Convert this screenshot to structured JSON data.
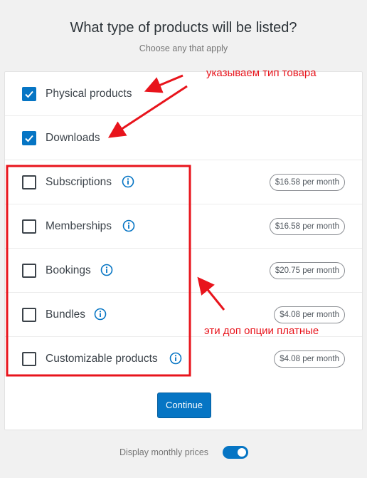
{
  "header": {
    "title": "What type of products will be listed?",
    "subtitle": "Choose any that apply"
  },
  "products": [
    {
      "label": "Physical products",
      "checked": true,
      "info": false,
      "price": ""
    },
    {
      "label": "Downloads",
      "checked": true,
      "info": false,
      "price": ""
    },
    {
      "label": "Subscriptions",
      "checked": false,
      "info": true,
      "price": "$16.58 per month"
    },
    {
      "label": "Memberships",
      "checked": false,
      "info": true,
      "price": "$16.58 per month"
    },
    {
      "label": "Bookings",
      "checked": false,
      "info": true,
      "price": "$20.75 per month"
    },
    {
      "label": "Bundles",
      "checked": false,
      "info": true,
      "price": "$4.08 per month"
    },
    {
      "label": "Customizable products",
      "checked": false,
      "info": true,
      "price": "$4.08 per month"
    }
  ],
  "actions": {
    "continue_label": "Continue"
  },
  "footer": {
    "toggle_label": "Display monthly prices",
    "toggle_on": true
  },
  "annotations": {
    "top_note": "указываем тип товара",
    "side_note": "эти доп опции платные"
  },
  "colors": {
    "accent": "#0675c4",
    "annotation": "#e8141c"
  }
}
